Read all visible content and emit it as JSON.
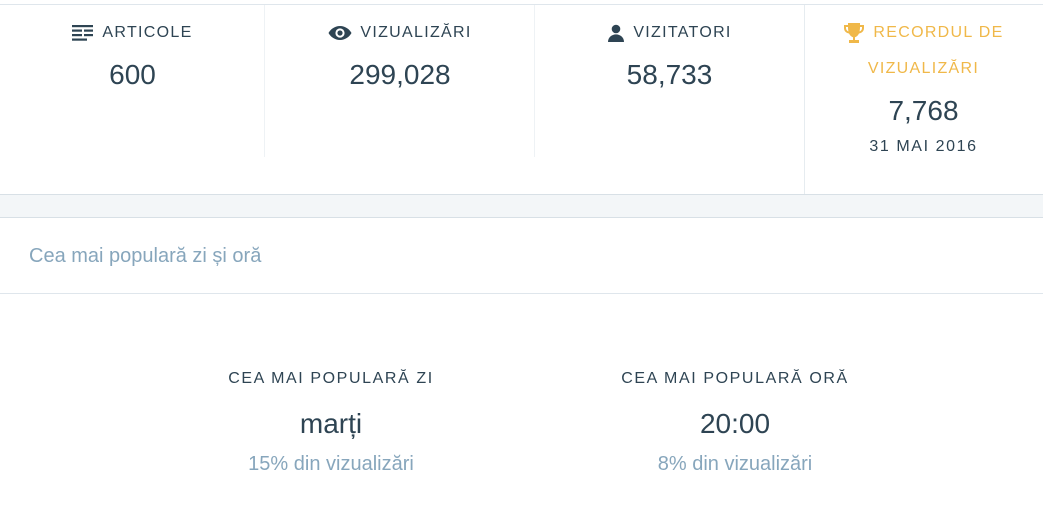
{
  "stats": [
    {
      "label": "ARTICOLE",
      "value": "600",
      "icon": "posts-icon"
    },
    {
      "label": "VIZUALIZĂRI",
      "value": "299,028",
      "icon": "eye-icon"
    },
    {
      "label": "VIZITATORI",
      "value": "58,733",
      "icon": "person-icon"
    }
  ],
  "record": {
    "label_line1": "RECORDUL DE",
    "label_line2": "VIZUALIZĂRI",
    "value": "7,768",
    "date": "31 MAI 2016",
    "icon": "trophy-icon",
    "accent_color": "#f0b849"
  },
  "section": {
    "title": "Cea mai populară zi și oră"
  },
  "popular_day": {
    "label": "CEA MAI POPULARĂ ZI",
    "value": "marți",
    "percent": "15% din vizualizări"
  },
  "popular_hour": {
    "label": "CEA MAI POPULARĂ ORĂ",
    "value": "20:00",
    "percent": "8% din vizualizări"
  },
  "colors": {
    "text": "#2e4453",
    "muted": "#87a6bc",
    "accent": "#f0b849"
  }
}
